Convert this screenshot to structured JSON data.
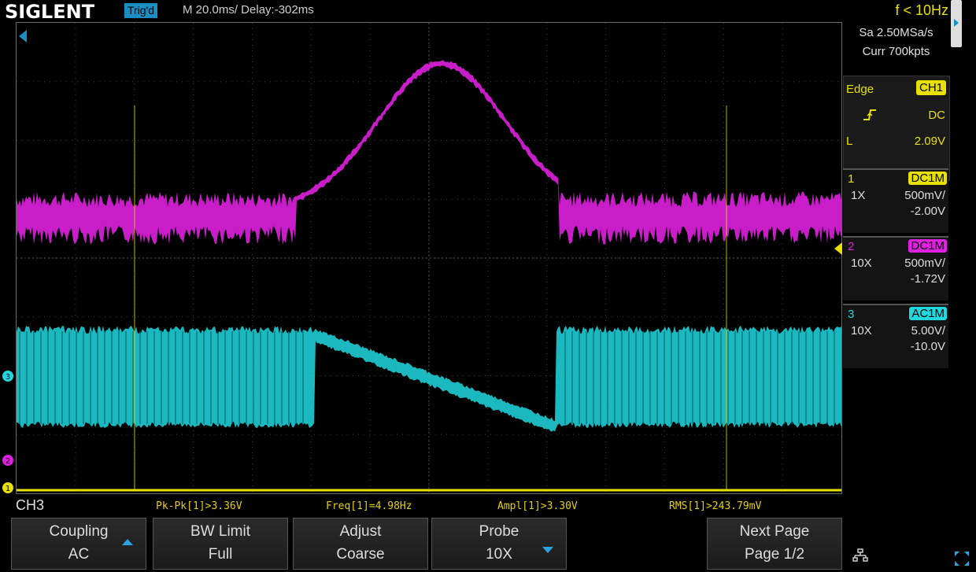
{
  "brand": "SIGLENT",
  "trigger_status": "Trig'd",
  "timebase": "M 20.0ms/ Delay:-302ms",
  "frequency_readout": "f < 10Hz",
  "sample_rate": "Sa 2.50MSa/s",
  "memory_depth": "Curr 700kpts",
  "trigger": {
    "type": "Edge",
    "source": "CH1",
    "slope_icon": "rising-edge-icon",
    "coupling": "DC",
    "level_label": "L",
    "level": "2.09V"
  },
  "channels": [
    {
      "num": "1",
      "coupling": "DC1M",
      "probe": "1X",
      "scale": "500mV/",
      "offset": "-2.00V",
      "color": "#e8e000"
    },
    {
      "num": "2",
      "coupling": "DC1M",
      "probe": "10X",
      "scale": "500mV/",
      "offset": "-1.72V",
      "color": "#e020e0"
    },
    {
      "num": "3",
      "coupling": "AC1M",
      "probe": "10X",
      "scale": "5.00V/",
      "offset": "-10.0V",
      "color": "#20d8e0"
    }
  ],
  "active_channel": "CH3",
  "measurements": [
    "Pk-Pk[1]>3.36V",
    "Freq[1]=4.98Hz",
    "Ampl[1]>3.30V",
    "RMS[1]>243.79mV"
  ],
  "softkeys": [
    {
      "line1": "Coupling",
      "line2": "AC"
    },
    {
      "line1": "BW Limit",
      "line2": "Full"
    },
    {
      "line1": "Adjust",
      "line2": "Coarse"
    },
    {
      "line1": "Probe",
      "line2": "10X"
    },
    {
      "line1": "Next Page",
      "line2": "Page 1/2"
    }
  ],
  "colors": {
    "ch1": "#e8e000",
    "ch2": "#e020e0",
    "ch3": "#20d8e0",
    "accent": "#1b8fc4"
  }
}
